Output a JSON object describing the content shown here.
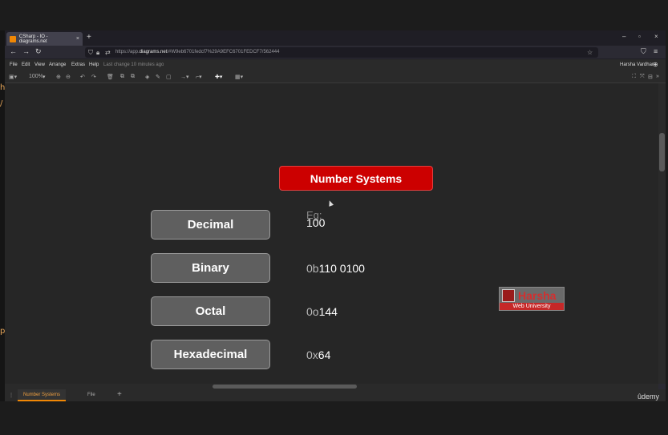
{
  "browser": {
    "tab_title": "CSharp - IO - diagrams.net",
    "tab_close": "×",
    "new_tab": "+",
    "window_controls": [
      "–",
      "▫",
      "×"
    ],
    "url_prefix": "https://app.",
    "url_domain": "diagrams.net",
    "url_rest": "/#W9eb6701fedcf7%29A9EFC6701FEDCF7/562444"
  },
  "menubar": {
    "items": [
      "File",
      "Edit",
      "View",
      "Arrange",
      "Extras",
      "Help"
    ],
    "last_change": "Last change 10 minutes ago",
    "user": "Harsha Vardhan"
  },
  "toolbar": {
    "zoom": "100%"
  },
  "diagram": {
    "title": "Number Systems",
    "eg_label": "Eg:",
    "rows": [
      {
        "name": "Decimal",
        "prefix": "",
        "value": "100"
      },
      {
        "name": "Binary",
        "prefix": "0b",
        "value": "110 0100"
      },
      {
        "name": "Octal",
        "prefix": "0o",
        "value": "144"
      },
      {
        "name": "Hexadecimal",
        "prefix": "0x",
        "value": "64"
      }
    ],
    "logo_name": "Harsha",
    "logo_sub": "Web University"
  },
  "pagetabs": {
    "active": "Number Systems",
    "other": "File",
    "add": "+",
    "brand": "ûdemy"
  }
}
